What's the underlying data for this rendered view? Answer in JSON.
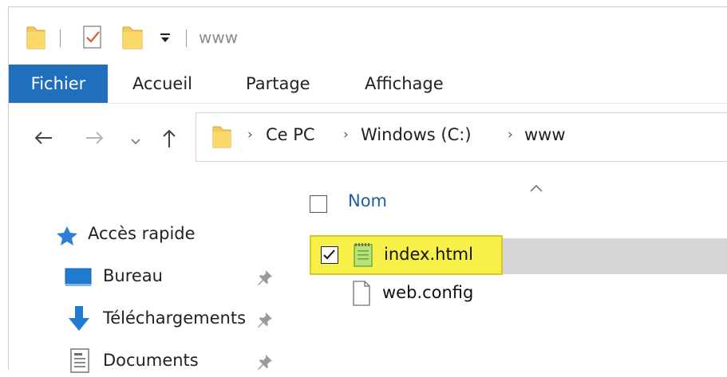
{
  "title": {
    "text": "www"
  },
  "ribbon": {
    "tabs": [
      {
        "label": "Fichier",
        "active": true
      },
      {
        "label": "Accueil"
      },
      {
        "label": "Partage"
      },
      {
        "label": "Affichage"
      }
    ]
  },
  "address": {
    "crumbs": [
      "Ce PC",
      "Windows (C:)",
      "www"
    ]
  },
  "sidebar": {
    "quick_access": "Accès rapide",
    "items": [
      {
        "label": "Bureau",
        "icon": "desktop-icon"
      },
      {
        "label": "Téléchargements",
        "icon": "download-icon"
      },
      {
        "label": "Documents",
        "icon": "documents-icon"
      }
    ]
  },
  "content": {
    "column_name": "Nom",
    "files": [
      {
        "name": "index.html",
        "selected": true,
        "checked": true,
        "highlighted": true,
        "icon": "notepad-file-icon"
      },
      {
        "name": "web.config",
        "selected": false,
        "checked": false,
        "icon": "blank-file-icon"
      }
    ]
  },
  "colors": {
    "accent": "#1f6fbd",
    "highlight": "#f6f048",
    "selection": "#d6d6d6"
  }
}
